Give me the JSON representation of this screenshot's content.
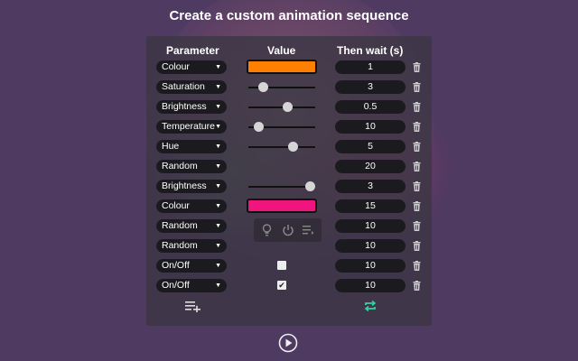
{
  "title": "Create a custom animation sequence",
  "headers": {
    "parameter": "Parameter",
    "value": "Value",
    "wait": "Then wait (s)"
  },
  "rows": [
    {
      "param": "Colour",
      "control": "color",
      "color": "#ff8000",
      "wait": "1"
    },
    {
      "param": "Saturation",
      "control": "slider",
      "level": 0.22,
      "wait": "3"
    },
    {
      "param": "Brightness",
      "control": "slider",
      "level": 0.58,
      "wait": "0.5"
    },
    {
      "param": "Temperature",
      "control": "slider",
      "level": 0.15,
      "wait": "10"
    },
    {
      "param": "Hue",
      "control": "slider",
      "level": 0.66,
      "wait": "5"
    },
    {
      "param": "Random",
      "control": "none",
      "wait": "20"
    },
    {
      "param": "Brightness",
      "control": "slider",
      "level": 0.92,
      "wait": "3"
    },
    {
      "param": "Colour",
      "control": "color",
      "color": "#f0157e",
      "wait": "15"
    },
    {
      "param": "Random",
      "control": "icons",
      "wait": "10"
    },
    {
      "param": "Random",
      "control": "none",
      "wait": "10"
    },
    {
      "param": "On/Off",
      "control": "checkbox",
      "checked": false,
      "wait": "10"
    },
    {
      "param": "On/Off",
      "control": "checkbox",
      "checked": true,
      "wait": "10"
    }
  ],
  "colors": {
    "background": "#4f3a62",
    "panel": "#3c3744",
    "loop_icon": "#33d1a0"
  },
  "icons": {
    "add": "add-row-icon",
    "loop": "loop-icon",
    "play": "play-icon",
    "delete": "trash-icon",
    "bulb": "bulb-icon",
    "power": "power-icon",
    "list": "list-icon"
  }
}
